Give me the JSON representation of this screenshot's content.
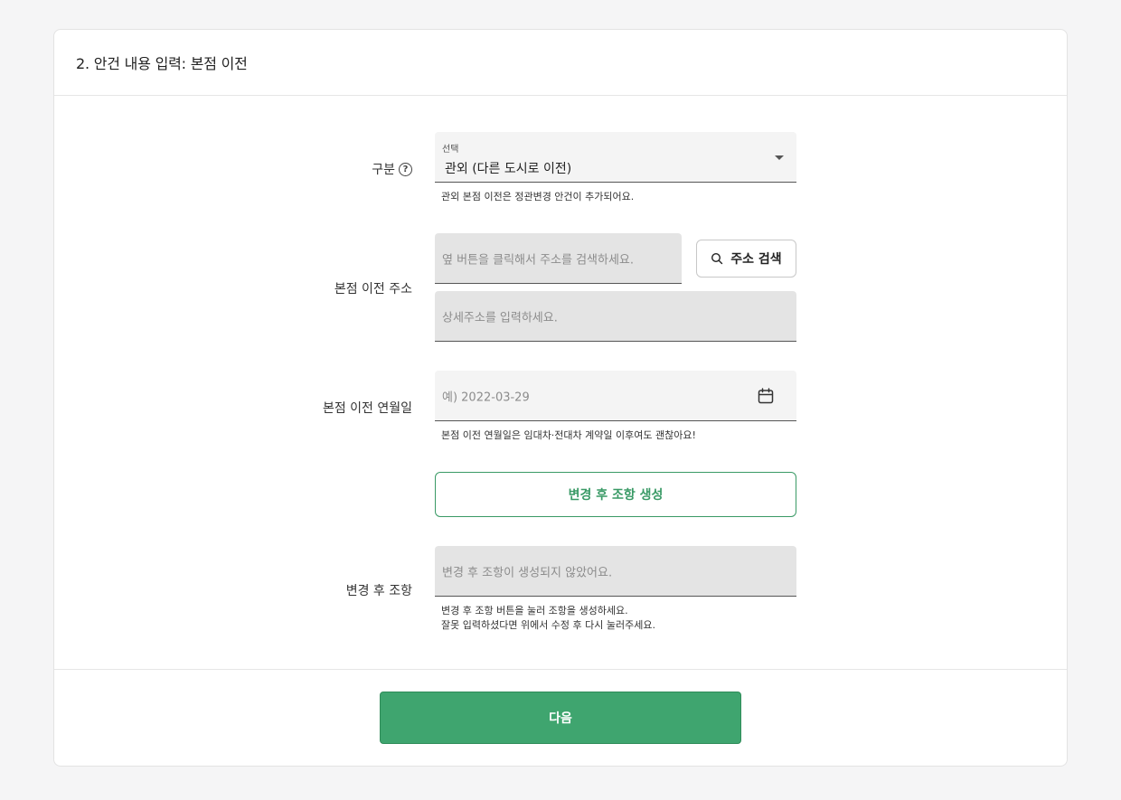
{
  "header": {
    "title": "2. 안건 내용 입력: 본점 이전"
  },
  "category": {
    "label": "구분",
    "help_glyph": "?",
    "select_label": "선택",
    "select_value": "관외 (다른 도시로 이전)",
    "helper": "관외 본점 이전은 정관변경 안건이 추가되어요."
  },
  "address": {
    "label": "본점 이전 주소",
    "search_placeholder": "옆 버튼을 클릭해서 주소를 검색하세요.",
    "search_button": "주소 검색",
    "detail_placeholder": "상세주소를 입력하세요."
  },
  "date": {
    "label": "본점 이전 연월일",
    "placeholder": "예) 2022-03-29",
    "helper": "본점 이전 연월일은 임대차·전대차 계약일 이후여도 괜찮아요!"
  },
  "generate_button": "변경 후 조항 생성",
  "clause": {
    "label": "변경 후 조항",
    "placeholder": "변경 후 조항이 생성되지 않았어요.",
    "helper_line1": "변경 후 조항 버튼을 눌러 조항을 생성하세요.",
    "helper_line2": "잘못 입력하셨다면 위에서 수정 후 다시 눌러주세요."
  },
  "next_button": "다음",
  "colors": {
    "primary": "#3fa56f",
    "primary_border": "#2f8c59",
    "outline_green": "#3a9a66"
  }
}
